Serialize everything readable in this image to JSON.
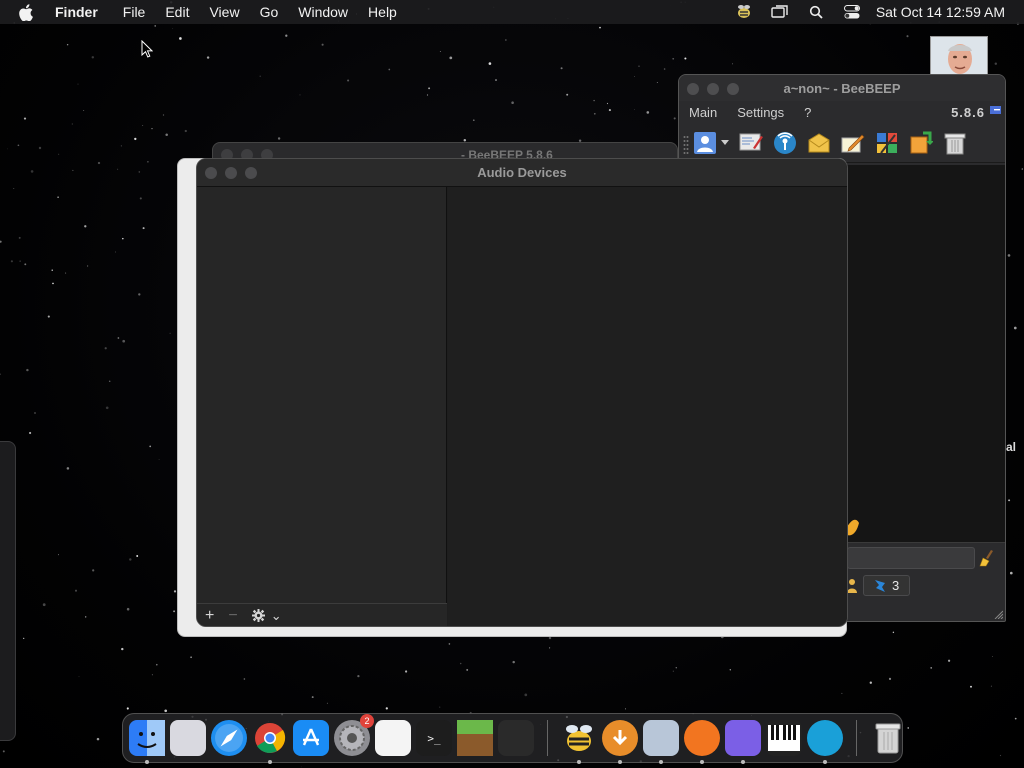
{
  "menubar": {
    "app_name": "Finder",
    "items": [
      "File",
      "Edit",
      "View",
      "Go",
      "Window",
      "Help"
    ],
    "clock": "Sat Oct 14  12:59 AM",
    "status_icons": [
      "beebeep-icon",
      "screen-mirroring-icon",
      "spotlight-search-icon",
      "control-center-icon"
    ]
  },
  "beebeep_main": {
    "title": "a~non~ - BeeBEEP",
    "menu": [
      "Main",
      "Settings",
      "?"
    ],
    "version": "5.8.6",
    "status_count": "3",
    "toolbar_icons": [
      "user-status-icon",
      "dropdown-icon",
      "edit-profile-icon",
      "broadcast-icon",
      "messages-icon",
      "write-message-icon",
      "plugins-icon",
      "file-transfer-icon",
      "trash-icon"
    ]
  },
  "beebeep_bg": {
    "title": "- BeeBEEP 5.8.6"
  },
  "audio_devices": {
    "title": "Audio Devices",
    "footer": {
      "add": "+",
      "remove": "−",
      "more": "⌄"
    }
  },
  "side_label": "al",
  "dock": {
    "items": [
      {
        "name": "finder",
        "running": true,
        "color": "#2d7cf6"
      },
      {
        "name": "launchpad",
        "running": false,
        "color": "#d9d9e0"
      },
      {
        "name": "safari",
        "running": false,
        "color": "#1e8ef0"
      },
      {
        "name": "chrome",
        "running": true,
        "color": "#e6e6e6"
      },
      {
        "name": "app-store",
        "running": false,
        "color": "#1a8cf5"
      },
      {
        "name": "system-settings",
        "running": false,
        "color": "#8e8e93",
        "badge": "2"
      },
      {
        "name": "textedit",
        "running": false,
        "color": "#f4f4f4"
      },
      {
        "name": "terminal",
        "running": false,
        "color": "#1d1d1d"
      },
      {
        "name": "minecraft",
        "running": false,
        "color": "#5c8d3a"
      },
      {
        "name": "chatgpt",
        "running": false,
        "color": "#2a2a2a"
      },
      {
        "name": "beebeep",
        "running": true,
        "color": "#f1c232"
      },
      {
        "name": "downloader",
        "running": true,
        "color": "#e88d2a"
      },
      {
        "name": "audio-midi-setup",
        "running": true,
        "color": "#b8c6d8"
      },
      {
        "name": "firefox",
        "running": true,
        "color": "#f27520"
      },
      {
        "name": "podcast-app",
        "running": true,
        "color": "#7b5fe6"
      },
      {
        "name": "piano",
        "running": false,
        "color": "#222222"
      },
      {
        "name": "edge",
        "running": true,
        "color": "#1aa0d8"
      },
      {
        "name": "trash",
        "running": false,
        "color": "#cfcfcf"
      }
    ]
  }
}
